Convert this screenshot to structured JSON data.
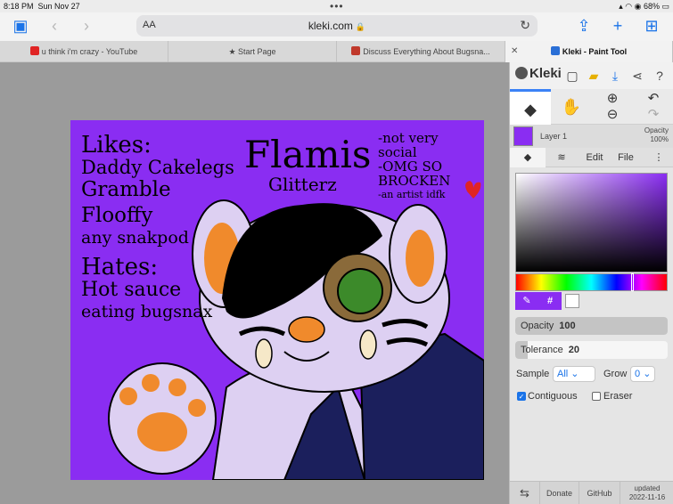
{
  "status_bar": {
    "time": "8:18 PM",
    "date": "Sun Nov 27",
    "battery": "68%"
  },
  "address_bar": {
    "text_size_label": "AA",
    "url": "kleki.com"
  },
  "tabs": [
    {
      "label": "u think i'm crazy - YouTube",
      "favicon_color": "#e02424"
    },
    {
      "label": "Start Page",
      "favicon_color": "#777777"
    },
    {
      "label": "Discuss Everything About Bugsna...",
      "favicon_color": "#c0392b"
    },
    {
      "label": "Kleki - Paint Tool",
      "favicon_color": "#2a6fd6",
      "active": true
    }
  ],
  "drawing": {
    "likes_title": "Likes:",
    "likes": [
      "Daddy Cakelegs",
      "Gramble",
      "Flooffy",
      "any snakpod"
    ],
    "hates_title": "Hates:",
    "hates": [
      "Hot sauce",
      "eating bugsnax"
    ],
    "name": "Flamis",
    "name_sub": "Glitterz",
    "notes": [
      "-not very",
      "social",
      "-OMG SO",
      "BROCKEN",
      "-an artist idfk"
    ],
    "background_color": "#8a2df2"
  },
  "app": {
    "name": "Kleki",
    "layer": {
      "name": "Layer 1",
      "opacity_label": "Opacity",
      "opacity_value": "100%"
    },
    "panel_tabs": [
      "Edit",
      "File"
    ],
    "color": {
      "current": "#8a2df2",
      "secondary": "#ffffff",
      "hex_label": "#"
    },
    "opacity": {
      "label": "Opacity",
      "value": "100",
      "fraction": 1.0
    },
    "tolerance": {
      "label": "Tolerance",
      "value": "20",
      "fraction": 0.08
    },
    "sample": {
      "label": "Sample",
      "value": "All"
    },
    "grow": {
      "label": "Grow",
      "value": "0"
    },
    "contiguous": {
      "label": "Contiguous",
      "checked": true
    },
    "eraser": {
      "label": "Eraser",
      "checked": false
    },
    "footer": {
      "donate": "Donate",
      "github": "GitHub",
      "updated_label": "updated",
      "updated_date": "2022-11-16"
    }
  }
}
